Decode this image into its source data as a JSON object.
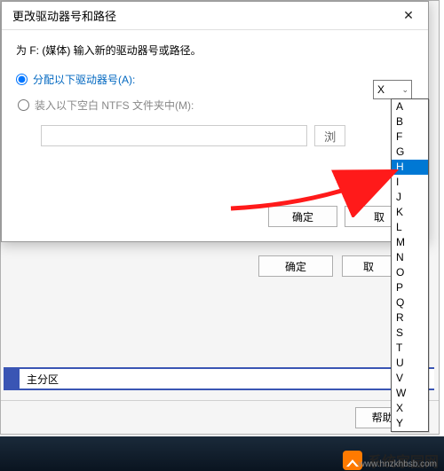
{
  "dialog": {
    "title": "更改驱动器号和路径",
    "instruction": "为 F: (媒体) 输入新的驱动器号或路径。",
    "option_assign": "分配以下驱动器号(A):",
    "option_mount": "装入以下空白 NTFS 文件夹中(M):",
    "browse": "浏",
    "ok": "确定",
    "cancel_partial": "取"
  },
  "outer": {
    "ok": "确定",
    "cancel_partial": "取",
    "partition_label": "主分区",
    "help": "帮助(H)"
  },
  "drive_select": {
    "current": "X",
    "highlighted": "H",
    "options": [
      "A",
      "B",
      "F",
      "G",
      "H",
      "I",
      "J",
      "K",
      "L",
      "M",
      "N",
      "O",
      "P",
      "Q",
      "R",
      "S",
      "T",
      "U",
      "V",
      "W",
      "X",
      "Y"
    ]
  },
  "watermark": {
    "text": "系统家园网",
    "url": "www.hnzkhbsb.com"
  }
}
